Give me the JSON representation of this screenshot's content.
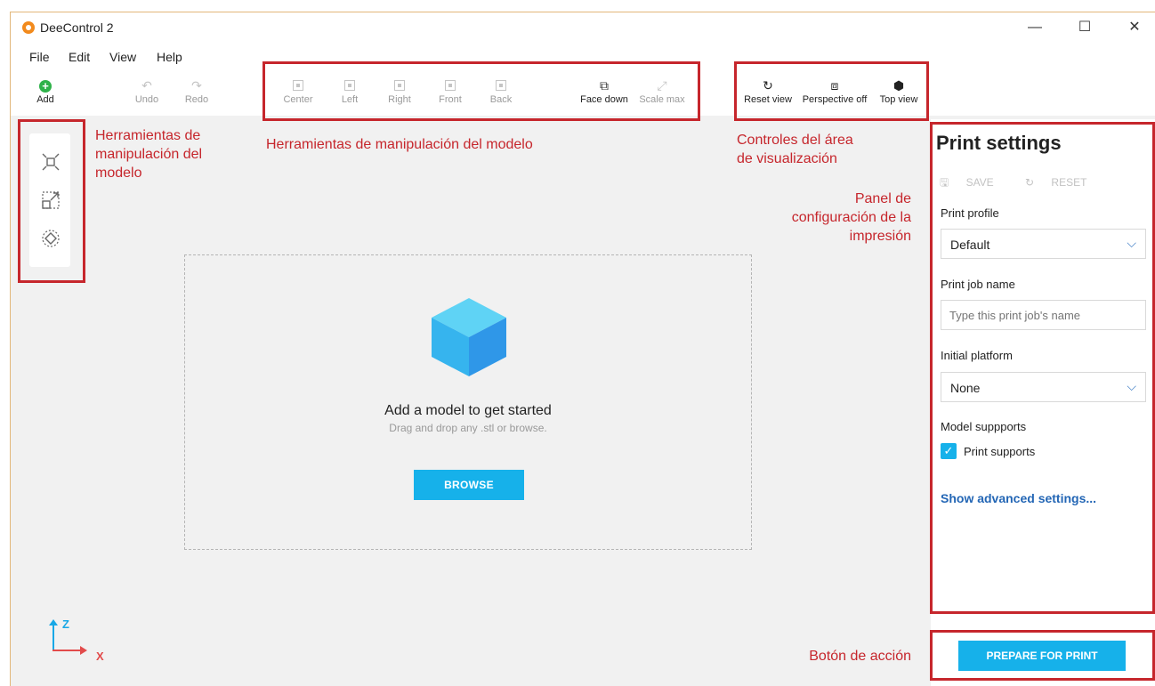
{
  "window": {
    "title": "DeeControl 2",
    "minimize": "—",
    "maximize": "☐",
    "close": "✕"
  },
  "menu": [
    "File",
    "Edit",
    "View",
    "Help"
  ],
  "toolbar": {
    "add": "Add",
    "undo": "Undo",
    "redo": "Redo",
    "center": "Center",
    "left": "Left",
    "right": "Right",
    "front": "Front",
    "back": "Back",
    "face_down": "Face down",
    "scale_max": "Scale max",
    "reset_view": "Reset view",
    "perspective_off": "Perspective off",
    "top_view": "Top view"
  },
  "annotations": {
    "left_tools_line1": "Herramientas de",
    "left_tools_line2": "manipulación del",
    "left_tools_line3": "modelo",
    "top_tools": "Herramientas de manipulación del modelo",
    "view_controls_line1": "Controles del área",
    "view_controls_line2": "de visualización",
    "panel_line1": "Panel de",
    "panel_line2": "configuración de la",
    "panel_line3": "impresión",
    "action": "Botón de acción"
  },
  "dropzone": {
    "title": "Add a model to get started",
    "subtitle": "Drag and drop any .stl or browse.",
    "browse": "BROWSE"
  },
  "axis": {
    "z": "Z",
    "x": "X"
  },
  "print_settings": {
    "title": "Print settings",
    "save": "SAVE",
    "reset": "RESET",
    "profile_label": "Print profile",
    "profile_value": "Default",
    "job_name_label": "Print job name",
    "job_name_placeholder": "Type this print job's name",
    "platform_label": "Initial platform",
    "platform_value": "None",
    "supports_label": "Model suppports",
    "supports_checkbox": "Print supports",
    "supports_checked": true,
    "advanced": "Show advanced settings..."
  },
  "action": {
    "prepare": "PREPARE FOR PRINT"
  },
  "colors": {
    "accent": "#16b1ea",
    "annotation": "#c6262c",
    "link": "#2366b5",
    "add": "#2fb24a"
  }
}
